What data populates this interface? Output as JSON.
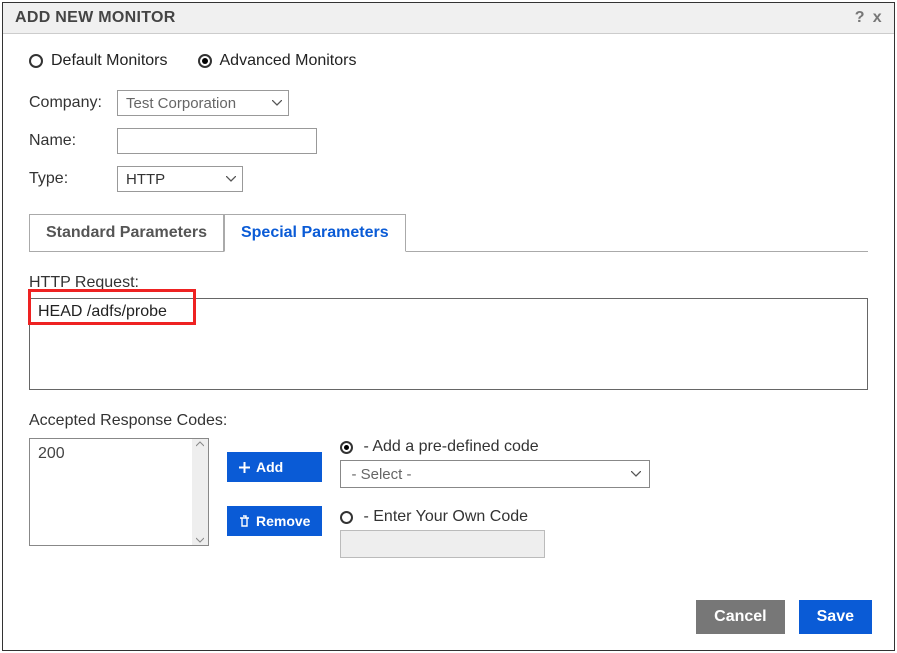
{
  "dialog": {
    "title": "ADD NEW MONITOR",
    "help_icon": "?",
    "close_icon": "x"
  },
  "monitor_type_radios": {
    "default": "Default Monitors",
    "advanced": "Advanced Monitors",
    "selected": "advanced"
  },
  "form": {
    "company_label": "Company:",
    "company_value": "Test Corporation",
    "name_label": "Name:",
    "name_value": "",
    "type_label": "Type:",
    "type_value": "HTTP"
  },
  "tabs": {
    "standard": "Standard Parameters",
    "special": "Special Parameters"
  },
  "http_request": {
    "label": "HTTP Request:",
    "value": "HEAD /adfs/probe"
  },
  "codes": {
    "label": "Accepted Response Codes:",
    "list": [
      "200"
    ],
    "add_btn": "Add",
    "remove_btn": "Remove",
    "predefined_label": "- Add a pre-defined code",
    "predefined_select": "- Select -",
    "own_label": "- Enter Your Own Code",
    "selected_option": "predefined"
  },
  "footer": {
    "cancel": "Cancel",
    "save": "Save"
  }
}
